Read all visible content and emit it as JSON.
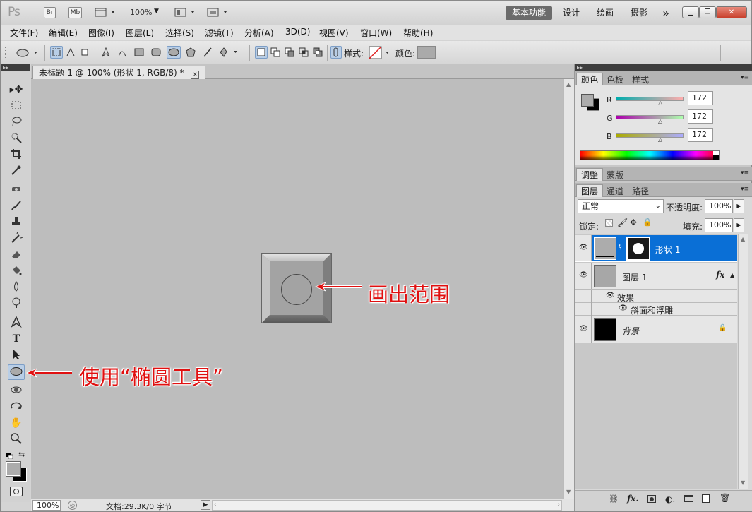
{
  "appbar": {
    "logo": "Ps",
    "bridge": "Br",
    "minibridge": "Mb",
    "zoom": "100%",
    "workspaces": [
      "基本功能",
      "设计",
      "绘画",
      "摄影"
    ],
    "more": "»",
    "window_controls": [
      "minimize-icon",
      "restore-icon",
      "close-icon"
    ]
  },
  "menus": [
    "文件(F)",
    "编辑(E)",
    "图像(I)",
    "图层(L)",
    "选择(S)",
    "滤镜(T)",
    "分析(A)",
    "3D(D)",
    "视图(V)",
    "窗口(W)",
    "帮助(H)"
  ],
  "options": {
    "style_label": "样式:",
    "color_label": "颜色:",
    "swatch": "#aaaaaa"
  },
  "document": {
    "tab_title": "未标题-1 @ 100% (形状 1, RGB/8) *",
    "close": "×",
    "zoom": "100%",
    "doc_info": "文档:29.3K/0 字节"
  },
  "annotations": {
    "shape": "画出范围",
    "tool": "使用“椭圆工具”"
  },
  "color_panel": {
    "tabs": [
      "颜色",
      "色板",
      "样式"
    ],
    "channels": [
      {
        "label": "R",
        "value": "172"
      },
      {
        "label": "G",
        "value": "172"
      },
      {
        "label": "B",
        "value": "172"
      }
    ],
    "fg": "#acacac",
    "bg": "#000000"
  },
  "adjust_panel": {
    "tabs": [
      "调整",
      "蒙版"
    ]
  },
  "layers_panel": {
    "tabs": [
      "图层",
      "通道",
      "路径"
    ],
    "blend_mode": "正常",
    "opacity_label": "不透明度:",
    "opacity": "100%",
    "lock_label": "锁定:",
    "fill_label": "填充:",
    "fill": "100%",
    "layers": [
      {
        "name": "形状 1",
        "selected": true
      },
      {
        "name": "图层 1",
        "fx": "fx"
      },
      {
        "name": "效果",
        "kind": "effects"
      },
      {
        "name": "斜面和浮雕",
        "kind": "effect"
      },
      {
        "name": "背景",
        "locked": true
      }
    ]
  },
  "colors": {
    "accent": "#0a6fd6",
    "annotation": "#e01010",
    "canvas": "#bdbdbd"
  }
}
